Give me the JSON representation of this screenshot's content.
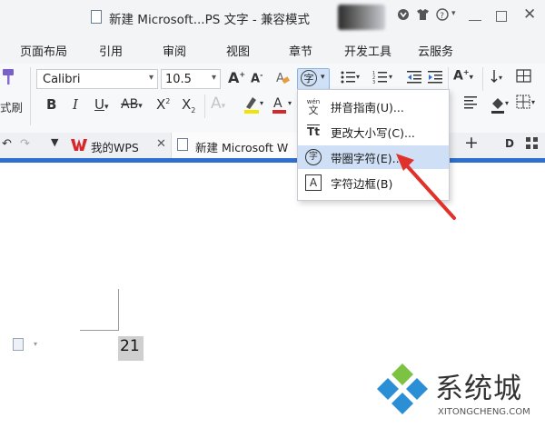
{
  "window": {
    "title": "新建 Microsoft...PS 文字 - 兼容模式"
  },
  "menu": {
    "items": [
      "页面布局",
      "引用",
      "审阅",
      "视图",
      "章节",
      "开发工具",
      "云服务"
    ]
  },
  "ribbon": {
    "left_partial_label": "式刷",
    "font_name": "Calibri",
    "font_size": "10.5",
    "grow_font": "A",
    "shrink_font": "A",
    "bold": "B",
    "italic": "I",
    "underline": "U",
    "strikethrough": "AB",
    "superscript": "X",
    "subscript": "X",
    "char_button_glyph": "字"
  },
  "tabs": {
    "wps_tab": "我的WPS",
    "doc_tab": "新建 Microsoft W"
  },
  "dropdown": {
    "items": [
      {
        "icon": "wén 文",
        "label": "拼音指南(U)..."
      },
      {
        "icon": "Tt",
        "label": "更改大小写(C)..."
      },
      {
        "icon": "字",
        "label": "带圈字符(E)..."
      },
      {
        "icon": "A",
        "label": "字符边框(B)"
      }
    ]
  },
  "document": {
    "number": "21"
  },
  "watermark": {
    "brand": "系统城",
    "url": "XITONGCHENG.COM"
  },
  "colors": {
    "accent_blue": "#2f6fd0",
    "menu_highlight": "#cfe0f6",
    "arrow_red": "#e0322b",
    "wps_red": "#d7262c"
  }
}
